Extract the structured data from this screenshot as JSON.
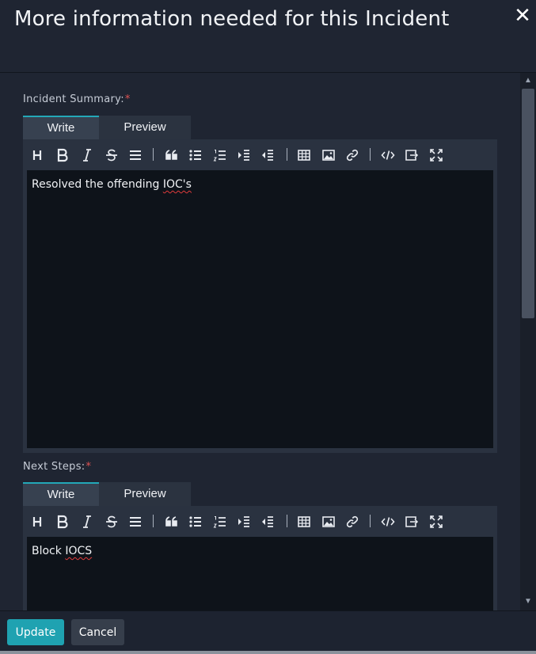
{
  "dialog": {
    "title": "More information needed for this Incident",
    "close_symbol": "✕"
  },
  "fields": [
    {
      "label": "Incident Summary:",
      "required_mark": "*",
      "tabs": {
        "write": "Write",
        "preview": "Preview"
      },
      "value_prefix": "Resolved the offending ",
      "value_flagged": "IOC's"
    },
    {
      "label": "Next Steps:",
      "required_mark": "*",
      "tabs": {
        "write": "Write",
        "preview": "Preview"
      },
      "value_prefix": "Block ",
      "value_flagged": "IOCS"
    }
  ],
  "toolbar_icons": [
    "heading-icon",
    "bold-icon",
    "italic-icon",
    "strikethrough-icon",
    "align-icon",
    "quote-icon",
    "bullet-list-icon",
    "numbered-list-icon",
    "indent-icon",
    "outdent-icon",
    "table-icon",
    "image-icon",
    "link-icon",
    "code-icon",
    "preview-icon",
    "fullscreen-icon"
  ],
  "footer": {
    "update_label": "Update",
    "cancel_label": "Cancel"
  },
  "colors": {
    "accent": "#1fa2b1",
    "required": "#e05252",
    "editor_bg": "#0e131a"
  }
}
